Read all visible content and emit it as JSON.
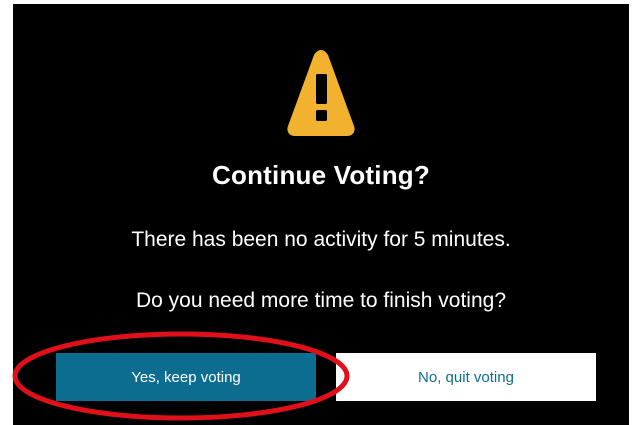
{
  "dialog": {
    "title": "Continue Voting?",
    "message_inactivity": "There has been no activity for 5 minutes.",
    "message_question": "Do you need more time to finish voting?",
    "yes_button_label": "Yes, keep voting",
    "no_button_label": "No, quit voting"
  },
  "icons": {
    "warning": "warning-triangle-icon"
  },
  "colors": {
    "background": "#000000",
    "warning": "#f2b12e",
    "primary_button": "#0d6d90",
    "secondary_button": "#ffffff",
    "annotation": "#e0101a"
  }
}
